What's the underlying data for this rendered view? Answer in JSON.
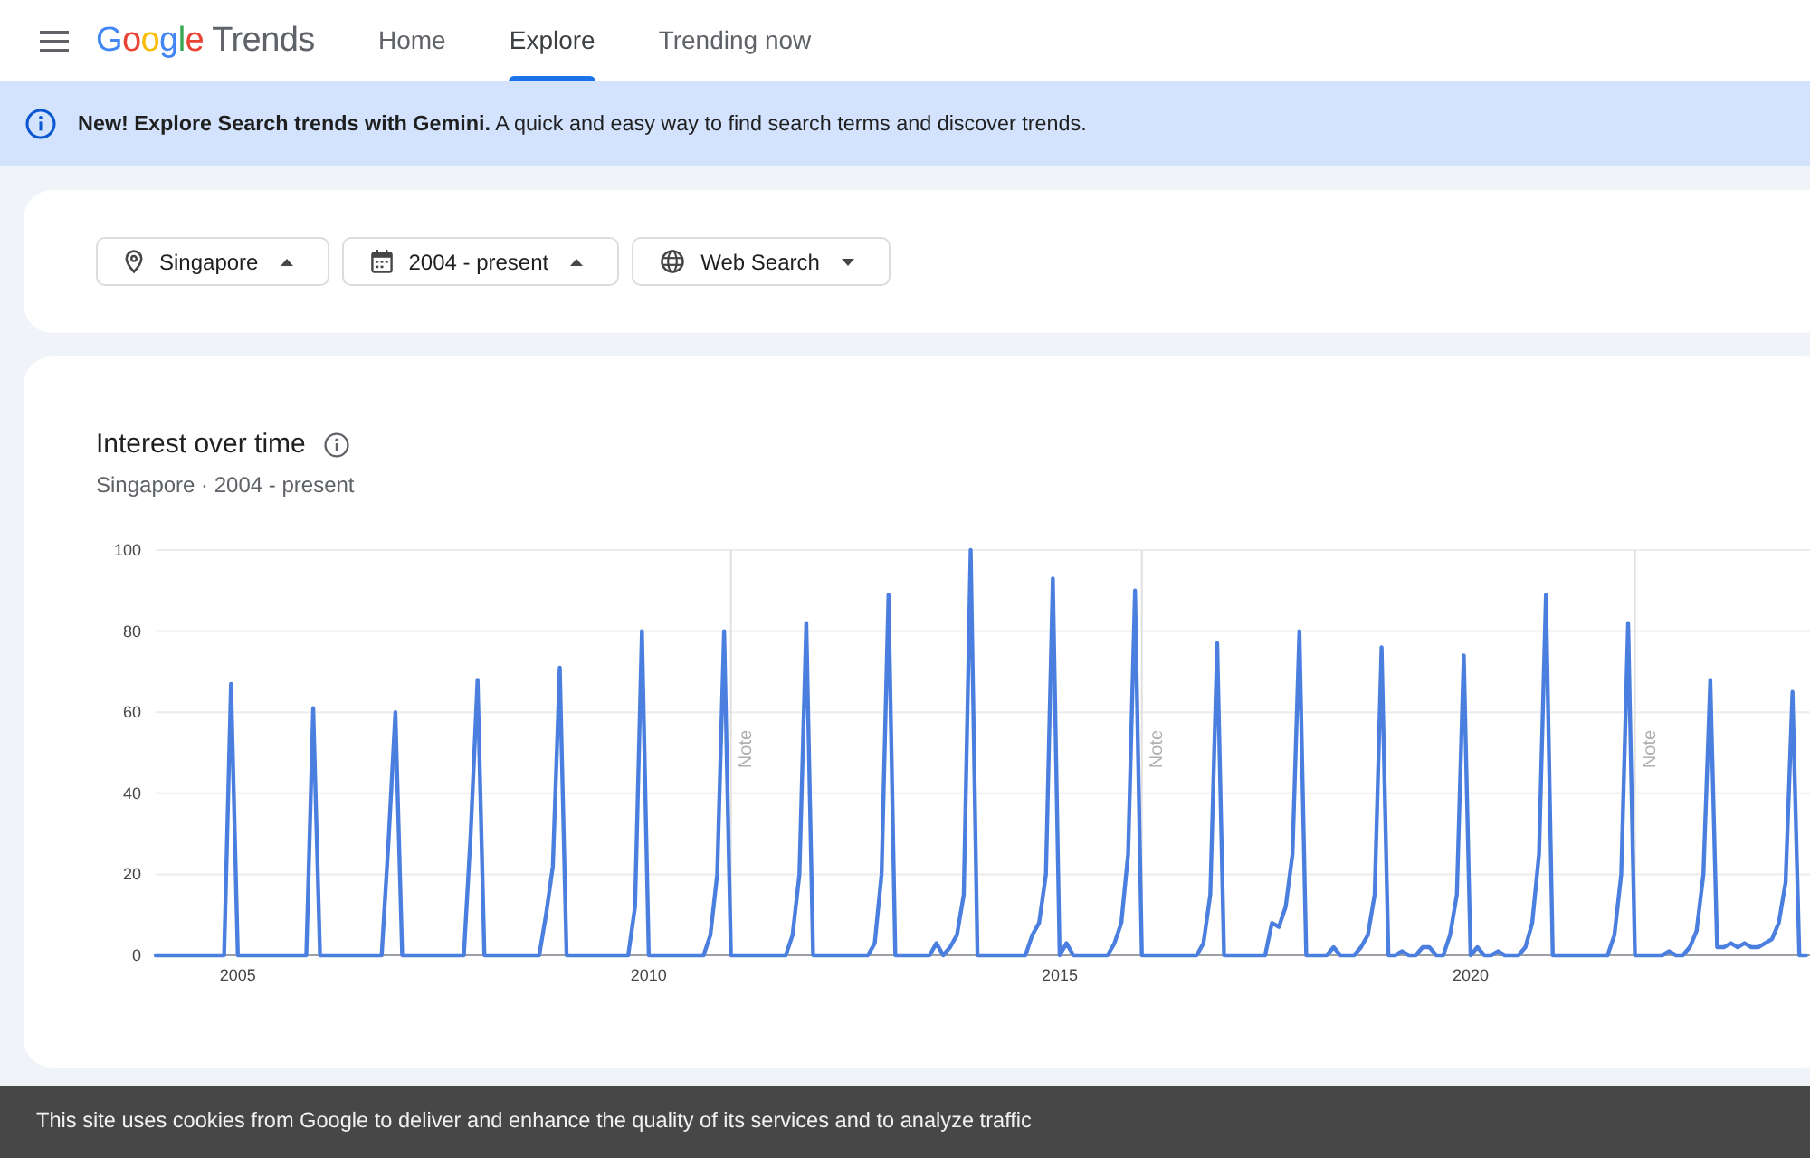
{
  "header": {
    "logo": {
      "brand": "Google",
      "product": "Trends"
    },
    "nav": [
      {
        "label": "Home",
        "selected": false
      },
      {
        "label": "Explore",
        "selected": true
      },
      {
        "label": "Trending now",
        "selected": false
      }
    ]
  },
  "banner": {
    "text": "**New! Explore Search trends with Gemini.** A quick and easy way to find search terms and discover trends."
  },
  "filters": [
    {
      "kind": "location",
      "label": "Singapore",
      "expanded": true
    },
    {
      "kind": "date",
      "label": "2004 - present",
      "expanded": true
    },
    {
      "kind": "property",
      "label": "Web Search",
      "expanded": false
    }
  ],
  "interest_over_time": {
    "title": "Interest over time",
    "subtitle": "Singapore · 2004 - present",
    "chart_data": {
      "type": "line",
      "x": [
        2004,
        2004.083,
        2004.167,
        2004.25,
        2004.333,
        2004.417,
        2004.5,
        2004.583,
        2004.667,
        2004.75,
        2004.833,
        2004.917,
        2005,
        2005.083,
        2005.167,
        2005.25,
        2005.333,
        2005.417,
        2005.5,
        2005.583,
        2005.667,
        2005.75,
        2005.833,
        2005.917,
        2006,
        2006.083,
        2006.167,
        2006.25,
        2006.333,
        2006.417,
        2006.5,
        2006.583,
        2006.667,
        2006.75,
        2006.833,
        2006.917,
        2007,
        2007.083,
        2007.167,
        2007.25,
        2007.333,
        2007.417,
        2007.5,
        2007.583,
        2007.667,
        2007.75,
        2007.833,
        2007.917,
        2008,
        2008.083,
        2008.167,
        2008.25,
        2008.333,
        2008.417,
        2008.5,
        2008.583,
        2008.667,
        2008.75,
        2008.833,
        2008.917,
        2009,
        2009.083,
        2009.167,
        2009.25,
        2009.333,
        2009.417,
        2009.5,
        2009.583,
        2009.667,
        2009.75,
        2009.833,
        2009.917,
        2010,
        2010.083,
        2010.167,
        2010.25,
        2010.333,
        2010.417,
        2010.5,
        2010.583,
        2010.667,
        2010.75,
        2010.833,
        2010.917,
        2011,
        2011.083,
        2011.167,
        2011.25,
        2011.333,
        2011.417,
        2011.5,
        2011.583,
        2011.667,
        2011.75,
        2011.833,
        2011.917,
        2012,
        2012.083,
        2012.167,
        2012.25,
        2012.333,
        2012.417,
        2012.5,
        2012.583,
        2012.667,
        2012.75,
        2012.833,
        2012.917,
        2013,
        2013.083,
        2013.167,
        2013.25,
        2013.333,
        2013.417,
        2013.5,
        2013.583,
        2013.667,
        2013.75,
        2013.833,
        2013.917,
        2014,
        2014.083,
        2014.167,
        2014.25,
        2014.333,
        2014.417,
        2014.5,
        2014.583,
        2014.667,
        2014.75,
        2014.833,
        2014.917,
        2015,
        2015.083,
        2015.167,
        2015.25,
        2015.333,
        2015.417,
        2015.5,
        2015.583,
        2015.667,
        2015.75,
        2015.833,
        2015.917,
        2016,
        2016.083,
        2016.167,
        2016.25,
        2016.333,
        2016.417,
        2016.5,
        2016.583,
        2016.667,
        2016.75,
        2016.833,
        2016.917,
        2017,
        2017.083,
        2017.167,
        2017.25,
        2017.333,
        2017.417,
        2017.5,
        2017.583,
        2017.667,
        2017.75,
        2017.833,
        2017.917,
        2018,
        2018.083,
        2018.167,
        2018.25,
        2018.333,
        2018.417,
        2018.5,
        2018.583,
        2018.667,
        2018.75,
        2018.833,
        2018.917,
        2019,
        2019.083,
        2019.167,
        2019.25,
        2019.333,
        2019.417,
        2019.5,
        2019.583,
        2019.667,
        2019.75,
        2019.833,
        2019.917,
        2020,
        2020.083,
        2020.167,
        2020.25,
        2020.333,
        2020.417,
        2020.5,
        2020.583,
        2020.667,
        2020.75,
        2020.833,
        2020.917,
        2021,
        2021.083,
        2021.167,
        2021.25,
        2021.333,
        2021.417,
        2021.5,
        2021.583,
        2021.667,
        2021.75,
        2021.833,
        2021.917,
        2022,
        2022.083,
        2022.167,
        2022.25,
        2022.333,
        2022.417,
        2022.5,
        2022.583,
        2022.667,
        2022.75,
        2022.833,
        2022.917,
        2023,
        2023.083,
        2023.167,
        2023.25,
        2023.333,
        2023.417,
        2023.5,
        2023.583,
        2023.667,
        2023.75,
        2023.833,
        2023.917,
        2024,
        2024.083
      ],
      "series": [
        {
          "color": "#4a7fe0",
          "values": [
            0,
            0,
            0,
            0,
            0,
            0,
            0,
            0,
            0,
            0,
            0,
            67,
            0,
            0,
            0,
            0,
            0,
            0,
            0,
            0,
            0,
            0,
            0,
            61,
            0,
            0,
            0,
            0,
            0,
            0,
            0,
            0,
            0,
            0,
            28,
            60,
            0,
            0,
            0,
            0,
            0,
            0,
            0,
            0,
            0,
            0,
            30,
            68,
            0,
            0,
            0,
            0,
            0,
            0,
            0,
            0,
            0,
            10,
            22,
            71,
            0,
            0,
            0,
            0,
            0,
            0,
            0,
            0,
            0,
            0,
            12,
            80,
            0,
            0,
            0,
            0,
            0,
            0,
            0,
            0,
            0,
            5,
            20,
            80,
            0,
            0,
            0,
            0,
            0,
            0,
            0,
            0,
            0,
            5,
            20,
            82,
            0,
            0,
            0,
            0,
            0,
            0,
            0,
            0,
            0,
            3,
            20,
            89,
            0,
            0,
            0,
            0,
            0,
            0,
            3,
            0,
            2,
            5,
            15,
            100,
            0,
            0,
            0,
            0,
            0,
            0,
            0,
            0,
            5,
            8,
            20,
            93,
            0,
            3,
            0,
            0,
            0,
            0,
            0,
            0,
            3,
            8,
            25,
            90,
            0,
            0,
            0,
            0,
            0,
            0,
            0,
            0,
            0,
            3,
            15,
            77,
            0,
            0,
            0,
            0,
            0,
            0,
            0,
            8,
            7,
            12,
            25,
            80,
            0,
            0,
            0,
            0,
            2,
            0,
            0,
            0,
            2,
            5,
            15,
            76,
            0,
            0,
            1,
            0,
            0,
            2,
            2,
            0,
            0,
            5,
            15,
            74,
            0,
            2,
            0,
            0,
            1,
            0,
            0,
            0,
            2,
            8,
            25,
            89,
            0,
            0,
            0,
            0,
            0,
            0,
            0,
            0,
            0,
            5,
            20,
            82,
            0,
            0,
            0,
            0,
            0,
            1,
            0,
            0,
            2,
            6,
            20,
            68,
            2,
            2,
            3,
            2,
            3,
            2,
            2,
            3,
            4,
            8,
            18,
            65,
            0,
            0
          ]
        }
      ],
      "xlim": [
        2004,
        2024.13
      ],
      "ylim": [
        0,
        100
      ],
      "xticks": [
        2005,
        2010,
        2015,
        2020
      ],
      "yticks": [
        0,
        20,
        40,
        60,
        80,
        100
      ],
      "grid": true,
      "annotations": [
        {
          "x": 2011,
          "text": "Note"
        },
        {
          "x": 2016,
          "text": "Note"
        },
        {
          "x": 2022,
          "text": "Note"
        }
      ]
    }
  },
  "cookie_bar": {
    "text": "This site uses cookies from Google to deliver and enhance the quality of its services and to analyze traffic"
  }
}
